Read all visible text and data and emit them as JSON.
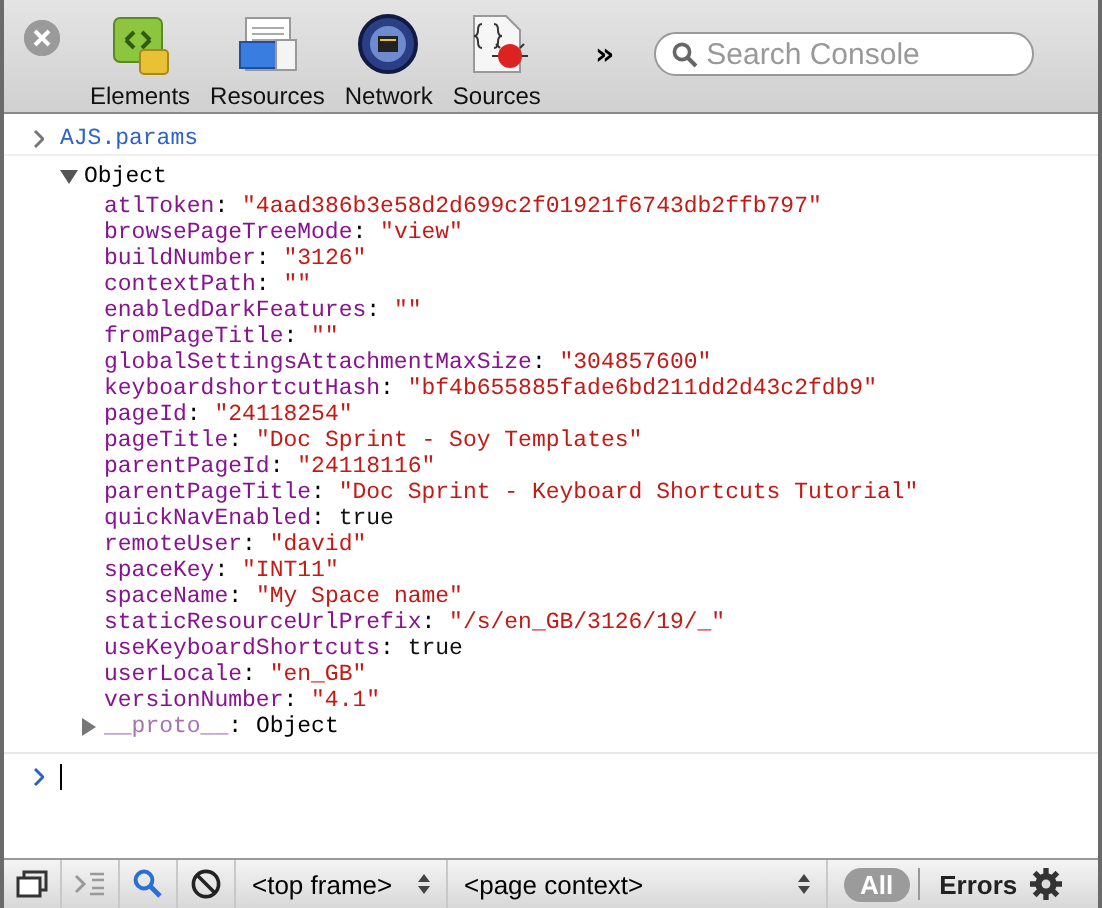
{
  "toolbar": {
    "panels": [
      {
        "label": "Elements",
        "kind": "elements"
      },
      {
        "label": "Resources",
        "kind": "resources"
      },
      {
        "label": "Network",
        "kind": "network"
      },
      {
        "label": "Sources",
        "kind": "sources"
      }
    ],
    "overflow": "»",
    "search": {
      "placeholder": "Search Console"
    }
  },
  "console": {
    "command": "AJS.params",
    "object": {
      "label": "Object",
      "expanded": true,
      "separator": ":",
      "properties": [
        {
          "key": "atlToken",
          "value": "\"4aad386b3e58d2d699c2f01921f6743db2ffb797\"",
          "kind": "string"
        },
        {
          "key": "browsePageTreeMode",
          "value": "\"view\"",
          "kind": "string"
        },
        {
          "key": "buildNumber",
          "value": "\"3126\"",
          "kind": "string"
        },
        {
          "key": "contextPath",
          "value": "\"\"",
          "kind": "string"
        },
        {
          "key": "enabledDarkFeatures",
          "value": "\"\"",
          "kind": "string"
        },
        {
          "key": "fromPageTitle",
          "value": "\"\"",
          "kind": "string"
        },
        {
          "key": "globalSettingsAttachmentMaxSize",
          "value": "\"304857600\"",
          "kind": "string"
        },
        {
          "key": "keyboardshortcutHash",
          "value": "\"bf4b655885fade6bd211dd2d43c2fdb9\"",
          "kind": "string"
        },
        {
          "key": "pageId",
          "value": "\"24118254\"",
          "kind": "string"
        },
        {
          "key": "pageTitle",
          "value": "\"Doc Sprint - Soy Templates\"",
          "kind": "string"
        },
        {
          "key": "parentPageId",
          "value": "\"24118116\"",
          "kind": "string"
        },
        {
          "key": "parentPageTitle",
          "value": "\"Doc Sprint - Keyboard Shortcuts Tutorial\"",
          "kind": "string"
        },
        {
          "key": "quickNavEnabled",
          "value": "true",
          "kind": "literal"
        },
        {
          "key": "remoteUser",
          "value": "\"david\"",
          "kind": "string"
        },
        {
          "key": "spaceKey",
          "value": "\"INT11\"",
          "kind": "string"
        },
        {
          "key": "spaceName",
          "value": "\"My Space name\"",
          "kind": "string"
        },
        {
          "key": "staticResourceUrlPrefix",
          "value": "\"/s/en_GB/3126/19/_\"",
          "kind": "string"
        },
        {
          "key": "useKeyboardShortcuts",
          "value": "true",
          "kind": "literal"
        },
        {
          "key": "userLocale",
          "value": "\"en_GB\"",
          "kind": "string"
        },
        {
          "key": "versionNumber",
          "value": "\"4.1\"",
          "kind": "string"
        }
      ],
      "proto": {
        "key": "__proto__",
        "value": "Object",
        "expanded": false
      }
    }
  },
  "status_bar": {
    "frame": "<top frame>",
    "context": "<page context>",
    "filters": [
      {
        "label": "All",
        "selected": true
      },
      {
        "label": "Errors",
        "selected": false
      }
    ]
  }
}
